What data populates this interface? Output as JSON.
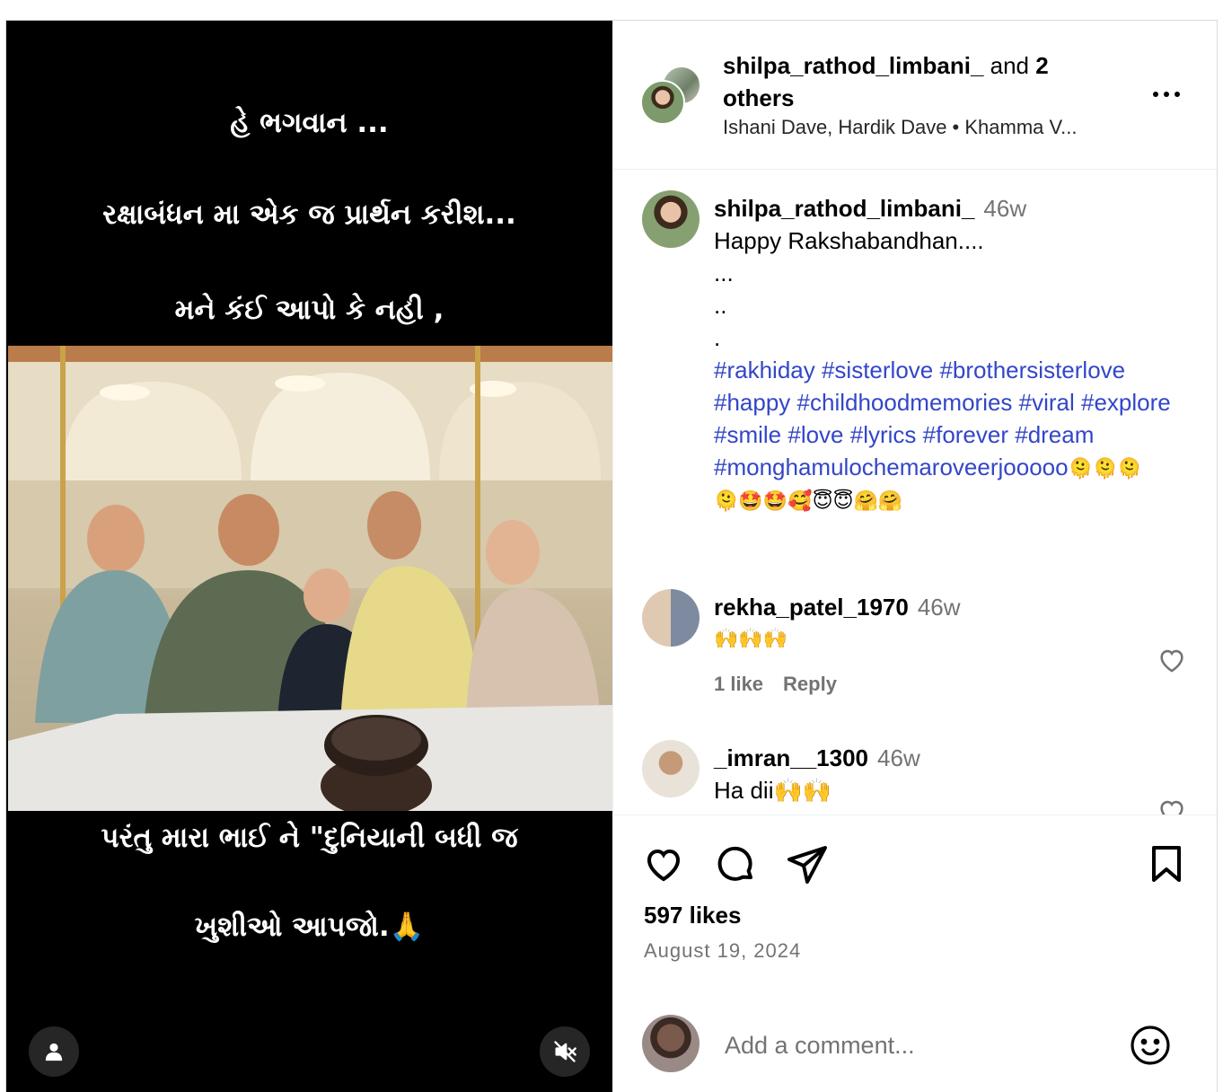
{
  "media": {
    "overlay_lines_top": [
      "હે ભગવાન ...",
      "રક્ષાબંધન મા એક જ પ્રાર્થન કરીશ...",
      "મને કંઈ આપો કે નહી ,"
    ],
    "overlay_lines_bottom": [
      "પરંતુ મારા ભાઈ ને \"દુનિયાની બધી જ",
      "ખુશીઓ આપજો.🙏"
    ],
    "photo_icon": "group-photo",
    "user_tag_icon": "person-icon",
    "mute_icon": "speaker-muted-icon"
  },
  "header": {
    "author": "shilpa_rathod_limbani_",
    "and_text": " and ",
    "others": "2 others",
    "subline": "Ishani Dave, Hardik Dave • Khamma V..."
  },
  "caption": {
    "user": "shilpa_rathod_limbani_",
    "time": "46w",
    "lines": [
      "Happy Rakshabandhan....",
      "...",
      "..",
      "."
    ],
    "hashtags": "#rakhiday #sisterlove #brothersisterlove #happy #childhoodmemories #viral #explore #smile #love #lyrics #forever #dream #monghamulochemaroveerjooooo",
    "emoji_tail": "🫠🫠🫠",
    "emoji_line": "🫠🤩🤩🥰😇😇🤗🤗"
  },
  "comments": [
    {
      "user": "rekha_patel_1970",
      "time": "46w",
      "text": "🙌🙌🙌",
      "likes": "1 like",
      "reply": "Reply"
    },
    {
      "user": "_imran__1300",
      "time": "46w",
      "text": "Ha dii🙌🙌"
    }
  ],
  "actions": {
    "likes": "597 likes",
    "date": "August 19, 2024",
    "comment_placeholder": "Add a comment..."
  },
  "colors": {
    "hashtag": "#3346c8",
    "muted": "#737373",
    "border": "#dbdbdb"
  }
}
